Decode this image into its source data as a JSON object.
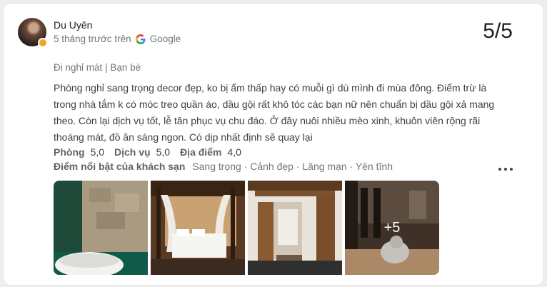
{
  "review": {
    "author": "Du Uyên",
    "time": "5 tháng trước trên",
    "source": "Google",
    "score": "5/5",
    "trip_type": "Đi nghỉ mát",
    "trip_company": "Bạn bè",
    "text": "Phòng nghỉ sang trọng decor đẹp, ko bị ẩm thấp hay có muỗi gì dù mình đi mùa đông. Điểm trừ là trong nhà tắm k có móc treo quần áo, dầu gội rất khô tóc các bạn nữ nên chuẩn bị dầu gội xả mang theo. Còn lại dịch vụ tốt, lễ tân phục vụ chu đáo. Ở đây nuôi nhiều mèo xinh, khuôn viên rộng rãi thoáng mát, đồ ăn sáng ngon. Có dịp nhất định sẽ quay lại",
    "subratings": [
      {
        "label": "Phòng",
        "value": "5,0"
      },
      {
        "label": "Dịch vụ",
        "value": "5,0"
      },
      {
        "label": "Địa điểm",
        "value": "4,0"
      }
    ],
    "highlights_label": "Điểm nổi bật của khách sạn",
    "highlights": "Sang trọng · Cảnh đẹp · Lãng mạn · Yên tĩnh",
    "more_photos": "+5"
  },
  "icons": {
    "more": "more-vert-icon",
    "google": "google-logo-icon"
  },
  "colors": {
    "text_primary": "#202124",
    "text_secondary": "#70757a",
    "badge": "#f4a428"
  }
}
